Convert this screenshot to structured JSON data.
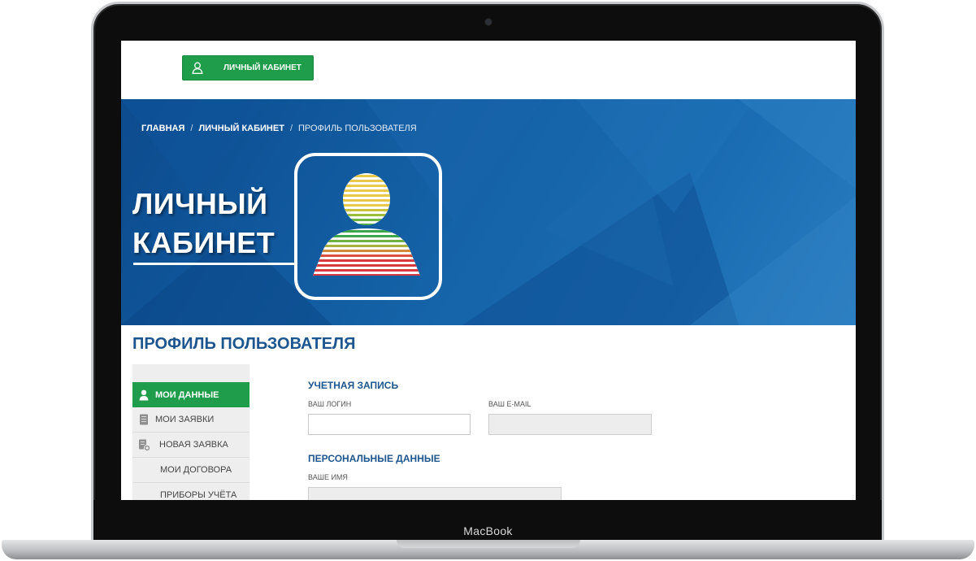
{
  "device": {
    "brand": "MacBook"
  },
  "header": {
    "cabinet_button": {
      "label": "ЛИЧНЫЙ КАБИНЕТ",
      "icon": "user-icon"
    }
  },
  "breadcrumb": {
    "items": [
      "ГЛАВНАЯ",
      "ЛИЧНЫЙ КАБИНЕТ",
      "ПРОФИЛЬ ПОЛЬЗОВАТЕЛЯ"
    ],
    "separator": "/"
  },
  "hero": {
    "title_line1": "ЛИЧНЫЙ",
    "title_line2": "КАБИНЕТ",
    "illustration_icon": "striped-user-avatar-icon"
  },
  "main": {
    "page_title": "ПРОФИЛЬ ПОЛЬЗОВАТЕЛЯ",
    "sidebar": {
      "items": [
        {
          "label": "МОИ ДАННЫЕ",
          "icon": "user-icon",
          "active": true
        },
        {
          "label": "МОИ ЗАЯВКИ",
          "icon": "document-icon",
          "active": false
        },
        {
          "label": "НОВАЯ ЗАЯВКА",
          "icon": "add-document-icon",
          "active": false
        },
        {
          "label": "МОИ ДОГОВОРА",
          "icon": "",
          "active": false
        },
        {
          "label": "ПРИБОРЫ УЧЁТА",
          "icon": "",
          "active": false
        }
      ]
    },
    "account": {
      "section_title": "УЧЕТНАЯ ЗАПИСЬ",
      "login_label": "ВАШ ЛОГИН",
      "login_value": "",
      "email_label": "ВАШ E-MAIL",
      "email_value": ""
    },
    "personal": {
      "section_title": "ПЕРСОНАЛЬНЫЕ ДАННЫЕ",
      "name_label": "ВАШЕ ИМЯ",
      "name_value": ""
    }
  },
  "colors": {
    "accent_green": "#1f9d4a",
    "hero_blue": "#1461a6",
    "title_blue": "#1d568f"
  }
}
